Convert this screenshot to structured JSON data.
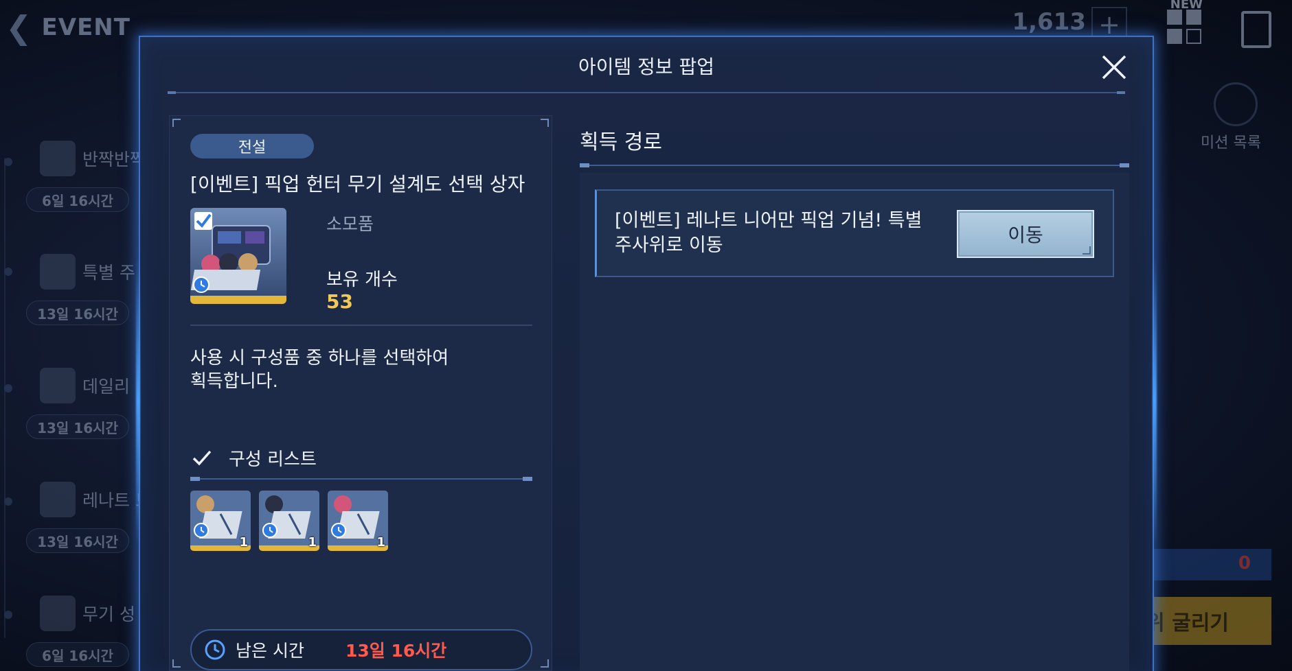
{
  "background": {
    "event_title": "EVENT",
    "currency": "1,613",
    "new_badge": "NEW",
    "mission_label": "미션 목록",
    "bottom_counter": "0",
    "bottom_button": "주사위 굴리기",
    "sidebar": [
      {
        "name": "반짝반짝",
        "time": "6일 16시간"
      },
      {
        "name": "특별 주",
        "time": "13일 16시간"
      },
      {
        "name": "데일리",
        "time": "13일 16시간"
      },
      {
        "name": "레나트 토너먼트",
        "time": "13일 16시간"
      },
      {
        "name": "무기 성",
        "time": "6일 16시간"
      }
    ]
  },
  "popup": {
    "title": "아이템 정보 팝업",
    "left": {
      "grade": "전설",
      "item_name": "[이벤트] 픽업 헌터 무기 설계도 선택 상자",
      "item_type": "소모품",
      "owned_label": "보유 개수",
      "owned_count": "53",
      "description": "사용 시 구성품 중 하나를 선택하여\n획득합니다.",
      "list_title": "구성 리스트",
      "components": [
        {
          "quantity": "1",
          "hair": "#c9a06a"
        },
        {
          "quantity": "1",
          "hair": "#2a2f44"
        },
        {
          "quantity": "1",
          "hair": "#d2557a"
        }
      ],
      "timer_label": "남은 시간",
      "timer_value": "13일 16시간"
    },
    "right": {
      "title": "획득 경로",
      "route_text": "[이벤트] 레나트 니어만 픽업 기념! 특별 주사위로 이동",
      "move_button": "이동"
    }
  },
  "colors": {
    "accent_blue": "#3f72c4",
    "timer_red": "#ff5a4e",
    "count_gold": "#f0c95a",
    "legend_frame": "#e3b73a"
  }
}
